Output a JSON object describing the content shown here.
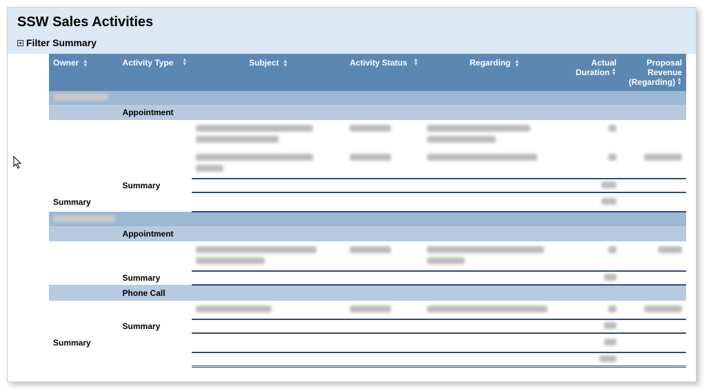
{
  "report": {
    "title": "SSW Sales Activities",
    "filter_label": "Filter Summary"
  },
  "columns": {
    "owner": "Owner",
    "activity_type": "Activity Type",
    "subject": "Subject",
    "activity_status": "Activity Status",
    "regarding": "Regarding",
    "actual_duration": "Actual Duration",
    "proposal_revenue": "Proposal Revenue (Regarding)"
  },
  "labels": {
    "summary": "Summary",
    "appointment": "Appointment",
    "phone_call": "Phone Call"
  }
}
